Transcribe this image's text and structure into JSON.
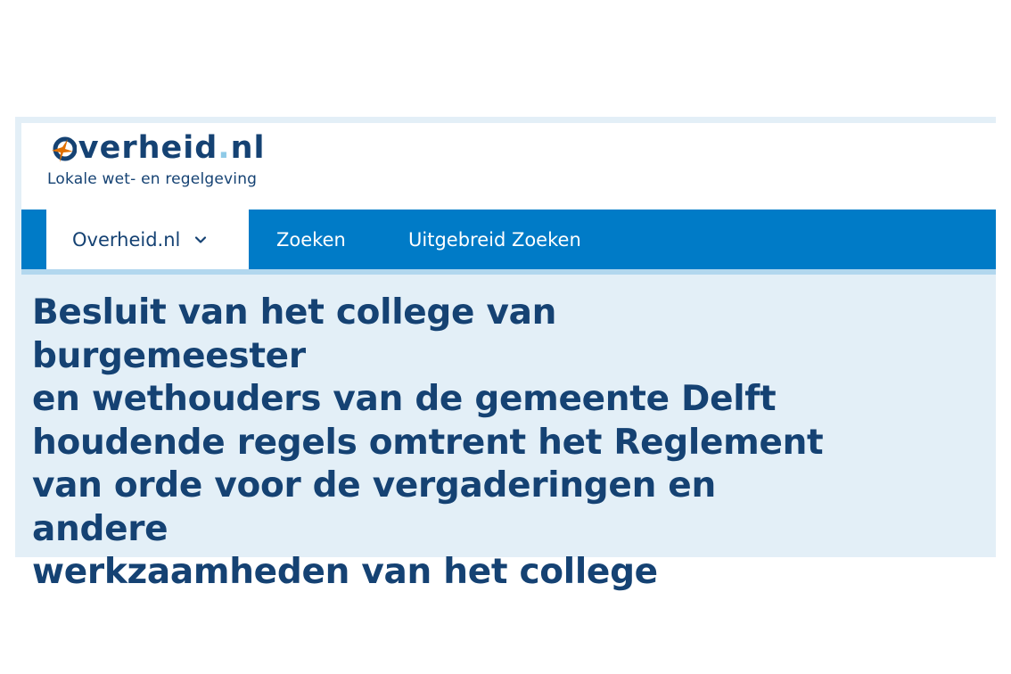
{
  "header": {
    "logo": {
      "name": "Overheid.nl",
      "first_letter": "O",
      "word_rest": "verheid",
      "dot": ".",
      "tld": "nl"
    },
    "tagline": "Lokale wet- en regelgeving"
  },
  "nav": {
    "items": [
      {
        "label": "Overheid.nl",
        "icon": "chevron-down-icon",
        "active": true
      },
      {
        "label": "Zoeken"
      },
      {
        "label": "Uitgebreid Zoeken"
      }
    ]
  },
  "main": {
    "title_lines": [
      "Besluit van het college van burgemeester",
      "en wethouders van de gemeente Delft",
      "houdende regels omtrent het Reglement",
      "van orde voor de vergaderingen en andere",
      "werkzaamheden van het college"
    ]
  },
  "colors": {
    "navy": "#154273",
    "nav_blue": "#007bc7",
    "light_bg": "#e3eff7",
    "accent_orange": "#e17000",
    "dot_blue": "#8fcae7"
  }
}
